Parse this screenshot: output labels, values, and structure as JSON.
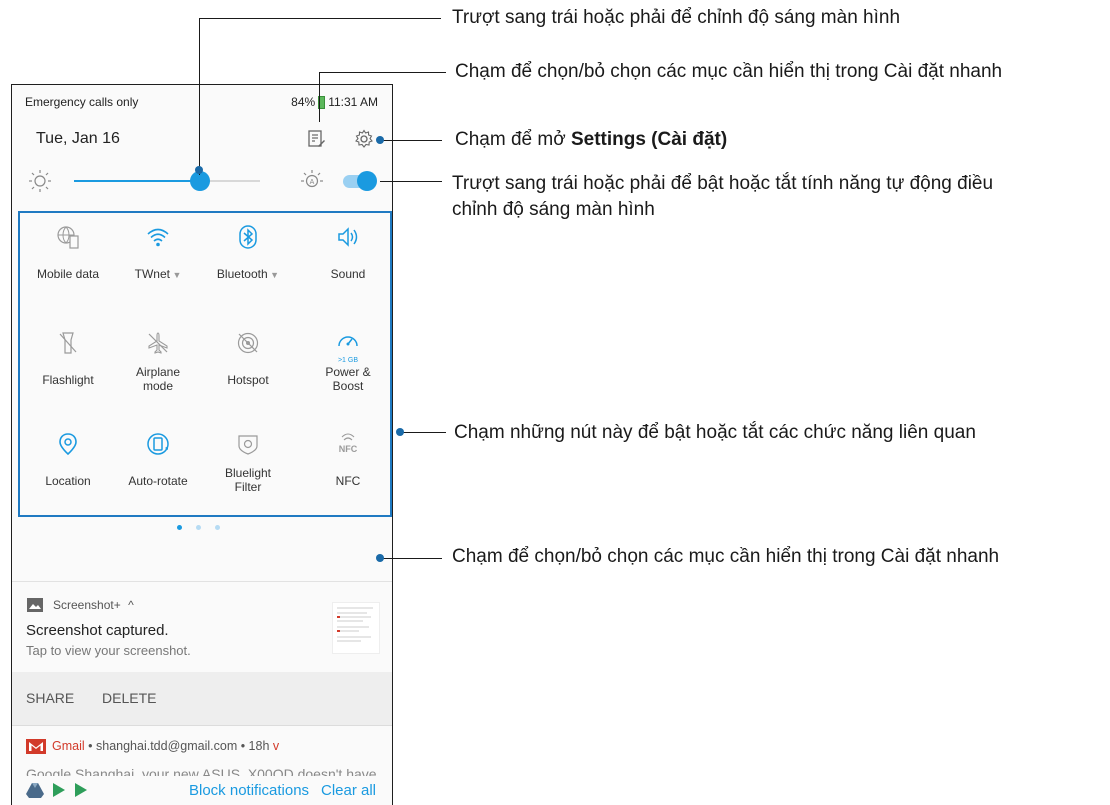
{
  "status_bar": {
    "left_text": "Emergency calls only",
    "battery": "84%",
    "time": "11:31 AM"
  },
  "header": {
    "date": "Tue, Jan 16"
  },
  "brightness": {
    "level": 0.68,
    "auto_enabled": true
  },
  "tiles": [
    {
      "label": "Mobile data",
      "icon": "mobile-data-icon",
      "caret": false
    },
    {
      "label": "TWnet",
      "icon": "wifi-icon",
      "caret": true
    },
    {
      "label": "Bluetooth",
      "icon": "bluetooth-icon",
      "caret": true
    },
    {
      "label": "Sound",
      "icon": "sound-icon",
      "caret": false
    },
    {
      "label": "Flashlight",
      "icon": "flashlight-icon",
      "caret": false
    },
    {
      "label": "Airplane\nmode",
      "icon": "airplane-icon",
      "caret": false
    },
    {
      "label": "Hotspot",
      "icon": "hotspot-icon",
      "caret": false
    },
    {
      "label": "Power &\nBoost",
      "icon": "power-boost-icon",
      "caret": false,
      "sublabel": ">1 GB"
    },
    {
      "label": "Location",
      "icon": "location-icon",
      "caret": false
    },
    {
      "label": "Auto-rotate",
      "icon": "auto-rotate-icon",
      "caret": false
    },
    {
      "label": "Bluelight\nFilter",
      "icon": "bluelight-filter-icon",
      "caret": false
    },
    {
      "label": "NFC",
      "icon": "nfc-icon",
      "caret": false
    }
  ],
  "pager": {
    "pages": 3,
    "active": 0
  },
  "notification": {
    "app": "Screenshot+",
    "expand_glyph": "^",
    "title": "Screenshot captured.",
    "body": "Tap to view your screenshot.",
    "actions": [
      "SHARE",
      "DELETE"
    ]
  },
  "notification2": {
    "app": "Gmail",
    "meta": "• shanghai.tdd@gmail.com • 18h",
    "expand_glyph": "v",
    "preview": "Google Shanghai, your new ASUS_X00QD doesn't have"
  },
  "footer": {
    "block_label": "Block notifications",
    "clear_label": "Clear all"
  },
  "callouts": {
    "brightness": "Trượt sang trái hoặc phải để chỉnh độ sáng màn hình",
    "edit": "Chạm để chọn/bỏ chọn các mục cần hiển thị trong Cài đặt nhanh",
    "settings_prefix": "Chạm để mở ",
    "settings_bold": "Settings (Cài đặt)",
    "auto_brightness_line1": "Trượt sang trái hoặc phải để bật hoặc tắt tính năng tự động điều",
    "auto_brightness_line2": "chỉnh độ sáng màn hình",
    "tiles": "Chạm những nút này để bật hoặc tắt các chức năng liên quan",
    "expand": "Chạm để chọn/bỏ chọn các mục cần hiển thị trong Cài đặt nhanh"
  },
  "colors": {
    "accent": "#1a9ae0",
    "gmail_red": "#d23a2a",
    "callout_line": "#1a1a1a"
  }
}
